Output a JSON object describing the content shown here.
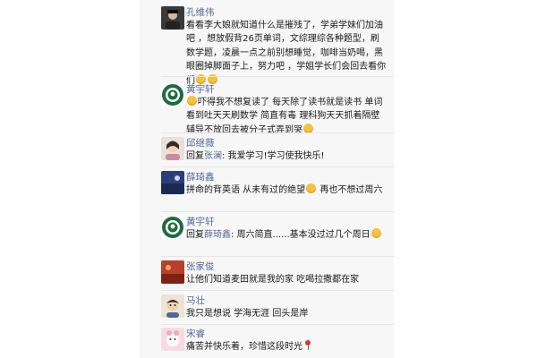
{
  "comments": [
    {
      "name": "孔维伟",
      "text": "看看李大娘就知道什么是摧残了，学弟学妹们加油吧 ，想放假背26页单词，文综理综各种题型，刷数学题，凌晨一点之前别想睡觉，咖啡当奶喝，黑眼圈掉脚面子上，努力吧 ，学姐学长们会回去看你们",
      "emoji_after": 2,
      "avatar": "avatar-person-dark"
    },
    {
      "name": "黄宇轩",
      "emoji_before": 1,
      "text": "吓得我不想复读了 每天除了读书就是读书 单词看到吐天天刷数学 简直有毒 理科狗天天抓着隔壁辅导不放回去被分子式弄到哭",
      "emoji_after": 1,
      "avatar": "avatar-starbucks-logo"
    },
    {
      "name": "邱继薇",
      "reply_prefix": "回复",
      "reply_to": "张澜",
      "text": ": 我爱学习!学习使我快乐!",
      "avatar": "avatar-person-girl"
    },
    {
      "name": "薛琦鑫",
      "text_before": "拼命的背英语  从未有过的绝望",
      "emoji_mid": 1,
      "text": " 再也不想过周六",
      "avatar": "avatar-blue-scene"
    },
    {
      "name": "黄宇轩",
      "reply_prefix": "回复",
      "reply_to": "薛琦鑫",
      "text": ": 周六简直......基本没过过几个周日",
      "emoji_after": 1,
      "avatar": "avatar-starbucks-logo"
    },
    {
      "name": "张家俊",
      "text": "让他们知道麦田就是我的家   吃喝拉撒都在家",
      "avatar": "avatar-red-field"
    },
    {
      "name": "马壮",
      "text": "我只是想说 学海无涯 回头是岸",
      "avatar": "avatar-person-cartoon"
    },
    {
      "name": "宋睿",
      "text": "痛苦并快乐着，珍惜这段时光",
      "emoji_rose": true,
      "avatar": "avatar-pink-cartoon"
    }
  ],
  "colors": {
    "name": "#576b95",
    "text": "#1a1a1a",
    "panel": "#f7f7f7"
  }
}
